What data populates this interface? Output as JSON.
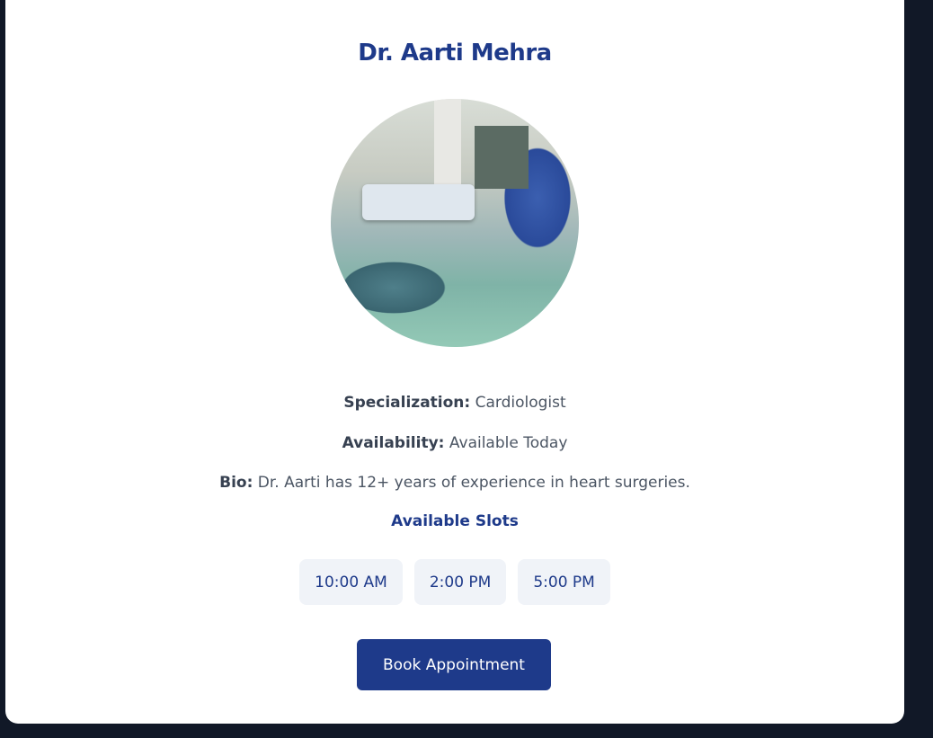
{
  "doctor": {
    "name": "Dr. Aarti Mehra",
    "photo_alt": "surgery-photo",
    "specialization_label": "Specialization:",
    "specialization": "Cardiologist",
    "availability_label": "Availability:",
    "availability": "Available Today",
    "bio_label": "Bio:",
    "bio": "Dr. Aarti has 12+ years of experience in heart surgeries."
  },
  "slots": {
    "title": "Available Slots",
    "items": [
      "10:00 AM",
      "2:00 PM",
      "5:00 PM"
    ]
  },
  "book_label": "Book Appointment",
  "colors": {
    "accent": "#1e3a8a",
    "background": "#111827",
    "slot_bg": "#f0f3f8"
  }
}
